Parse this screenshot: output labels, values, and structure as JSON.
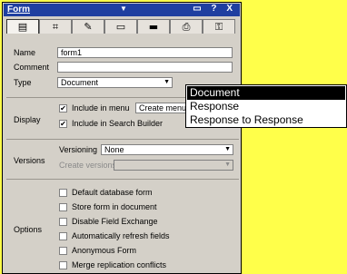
{
  "window": {
    "title": "Form",
    "dropdown_icon": "chevron-down-icon",
    "controls": "▭ ? X"
  },
  "tabs": [
    {
      "icon": "basics-icon",
      "glyph": "▤"
    },
    {
      "icon": "fields-icon",
      "glyph": "⌗"
    },
    {
      "icon": "launch-icon",
      "glyph": "✎"
    },
    {
      "icon": "defaults-icon",
      "glyph": "▭"
    },
    {
      "icon": "printing-icon",
      "glyph": "▬"
    },
    {
      "icon": "print-icon",
      "glyph": "⎙"
    },
    {
      "icon": "security-icon",
      "glyph": "⚿"
    }
  ],
  "basics": {
    "name_label": "Name",
    "name_value": "form1",
    "comment_label": "Comment",
    "comment_value": "",
    "type_label": "Type",
    "type_value": "Document"
  },
  "display": {
    "label": "Display",
    "include_in_menu": "Include in menu",
    "include_in_menu_checked": true,
    "menu_option": "Create menu",
    "include_in_search": "Include in Search Builder",
    "include_in_search_checked": true
  },
  "versions": {
    "label": "Versions",
    "versioning_label": "Versioning",
    "versioning_value": "None",
    "create_versions_label": "Create versions",
    "create_versions_value": ""
  },
  "options": {
    "label": "Options",
    "items": [
      {
        "label": "Default database form",
        "checked": false
      },
      {
        "label": "Store form in document",
        "checked": false
      },
      {
        "label": "Disable Field Exchange",
        "checked": false
      },
      {
        "label": "Automatically refresh fields",
        "checked": false
      },
      {
        "label": "Anonymous Form",
        "checked": false
      },
      {
        "label": "Merge replication conflicts",
        "checked": false
      }
    ]
  },
  "type_dropdown": {
    "options": [
      "Document",
      "Response",
      "Response to Response"
    ],
    "selected": "Document"
  }
}
